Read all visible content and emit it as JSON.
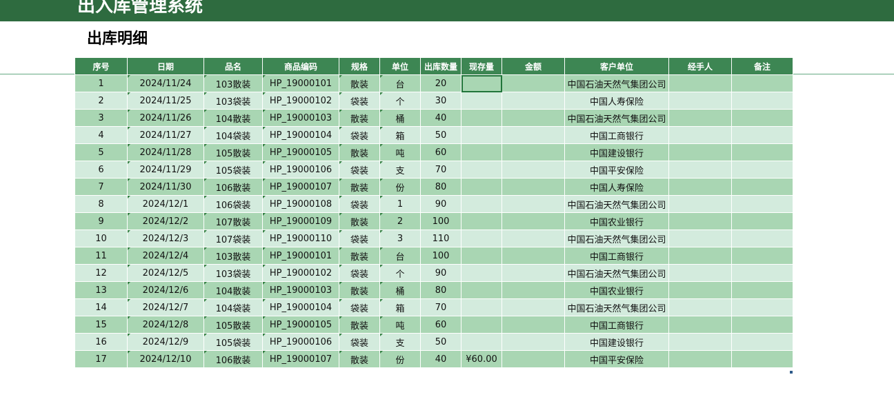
{
  "app": {
    "title": "出入库管理系统"
  },
  "sheet": {
    "title": "出库明细"
  },
  "table": {
    "columns": [
      "序号",
      "日期",
      "品名",
      "商品编码",
      "规格",
      "单位",
      "出库数量",
      "现存量",
      "金额",
      "客户单位",
      "经手人",
      "备注"
    ],
    "rows": [
      [
        "1",
        "2024/11/24",
        "103散装",
        "HP_19000101",
        "散装",
        "台",
        "20",
        "",
        "",
        "中国石油天然气集团公司",
        "",
        ""
      ],
      [
        "2",
        "2024/11/25",
        "103袋装",
        "HP_19000102",
        "袋装",
        "个",
        "30",
        "",
        "",
        "中国人寿保险",
        "",
        ""
      ],
      [
        "3",
        "2024/11/26",
        "104散装",
        "HP_19000103",
        "散装",
        "桶",
        "40",
        "",
        "",
        "中国石油天然气集团公司",
        "",
        ""
      ],
      [
        "4",
        "2024/11/27",
        "104袋装",
        "HP_19000104",
        "袋装",
        "箱",
        "50",
        "",
        "",
        "中国工商银行",
        "",
        ""
      ],
      [
        "5",
        "2024/11/28",
        "105散装",
        "HP_19000105",
        "散装",
        "吨",
        "60",
        "",
        "",
        "中国建设银行",
        "",
        ""
      ],
      [
        "6",
        "2024/11/29",
        "105袋装",
        "HP_19000106",
        "袋装",
        "支",
        "70",
        "",
        "",
        "中国平安保险",
        "",
        ""
      ],
      [
        "7",
        "2024/11/30",
        "106散装",
        "HP_19000107",
        "散装",
        "份",
        "80",
        "",
        "",
        "中国人寿保险",
        "",
        ""
      ],
      [
        "8",
        "2024/12/1",
        "106袋装",
        "HP_19000108",
        "袋装",
        "1",
        "90",
        "",
        "",
        "中国石油天然气集团公司",
        "",
        ""
      ],
      [
        "9",
        "2024/12/2",
        "107散装",
        "HP_19000109",
        "散装",
        "2",
        "100",
        "",
        "",
        "中国农业银行",
        "",
        ""
      ],
      [
        "10",
        "2024/12/3",
        "107袋装",
        "HP_19000110",
        "袋装",
        "3",
        "110",
        "",
        "",
        "中国石油天然气集团公司",
        "",
        ""
      ],
      [
        "11",
        "2024/12/4",
        "103散装",
        "HP_19000101",
        "散装",
        "台",
        "100",
        "",
        "",
        "中国工商银行",
        "",
        ""
      ],
      [
        "12",
        "2024/12/5",
        "103袋装",
        "HP_19000102",
        "袋装",
        "个",
        "90",
        "",
        "",
        "中国石油天然气集团公司",
        "",
        ""
      ],
      [
        "13",
        "2024/12/6",
        "104散装",
        "HP_19000103",
        "散装",
        "桶",
        "80",
        "",
        "",
        "中国农业银行",
        "",
        ""
      ],
      [
        "14",
        "2024/12/7",
        "104袋装",
        "HP_19000104",
        "袋装",
        "箱",
        "70",
        "",
        "",
        "中国石油天然气集团公司",
        "",
        ""
      ],
      [
        "15",
        "2024/12/8",
        "105散装",
        "HP_19000105",
        "散装",
        "吨",
        "60",
        "",
        "",
        "中国工商银行",
        "",
        ""
      ],
      [
        "16",
        "2024/12/9",
        "105袋装",
        "HP_19000106",
        "袋装",
        "支",
        "50",
        "",
        "",
        "中国建设银行",
        "",
        ""
      ],
      [
        "17",
        "2024/12/10",
        "106散装",
        "HP_19000107",
        "散装",
        "份",
        "40",
        "¥60.00",
        "",
        "中国平安保险",
        "",
        ""
      ]
    ]
  },
  "colors": {
    "title_bar": "#2e6b3f",
    "header": "#3d8653",
    "row_dark": "#a9d6b3",
    "row_light": "#d3ebdd"
  }
}
